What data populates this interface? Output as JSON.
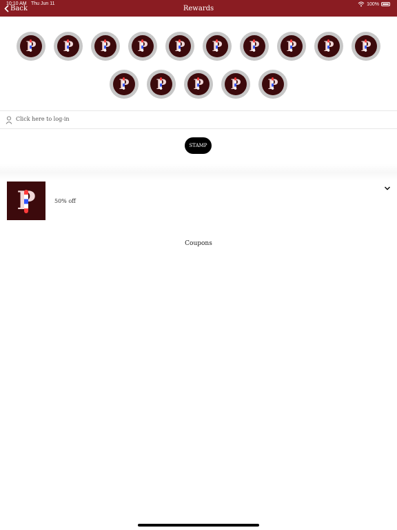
{
  "status": {
    "time": "10:10 AM",
    "date": "Thu Jun 11",
    "battery": "100%"
  },
  "nav": {
    "back_label": "Back",
    "title": "Rewards"
  },
  "stamps": {
    "row1_count": 10,
    "row2_count": 5,
    "letter": "P"
  },
  "login": {
    "text": "Click here to log-in"
  },
  "stamp_button": {
    "label": "STAMP"
  },
  "coupon": {
    "label": "50% off",
    "thumb_letter": "P"
  },
  "coupons_section": {
    "title": "Coupons"
  },
  "colors": {
    "header": "#8a1c22",
    "stamp_bg": "#3c0a0c",
    "stamp_ring": "#c7c7c7",
    "button": "#000000"
  }
}
